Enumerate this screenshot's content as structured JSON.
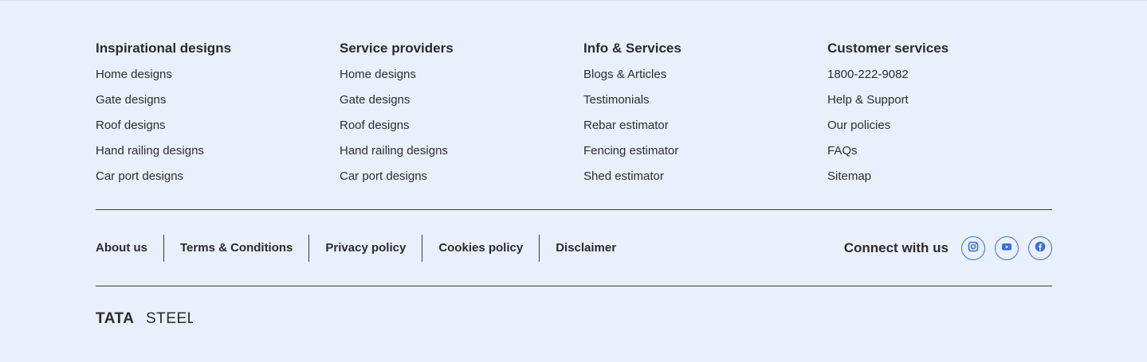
{
  "colors": {
    "background": "#e9f0fb",
    "text": "#2b2b2b",
    "divider": "#3a3a3a",
    "social_accent": "#3b6fd4"
  },
  "columns": [
    {
      "heading": "Inspirational designs",
      "items": [
        "Home designs",
        "Gate designs",
        "Roof designs",
        "Hand railing designs",
        "Car port designs"
      ]
    },
    {
      "heading": "Service providers",
      "items": [
        "Home designs",
        "Gate designs",
        "Roof designs",
        "Hand railing designs",
        "Car port designs"
      ]
    },
    {
      "heading": "Info & Services",
      "items": [
        "Blogs & Articles",
        "Testimonials",
        "Rebar estimator",
        "Fencing estimator",
        "Shed estimator"
      ]
    },
    {
      "heading": "Customer services",
      "items": [
        "1800-222-9082",
        "Help & Support",
        "Our policies",
        "FAQs",
        "Sitemap"
      ]
    }
  ],
  "legal": {
    "about": "About us",
    "terms": "Terms & Conditions",
    "privacy": "Privacy policy",
    "cookies": "Cookies policy",
    "disclaimer": "Disclaimer"
  },
  "connect": {
    "label": "Connect with us",
    "icons": [
      "instagram-icon",
      "youtube-icon",
      "facebook-icon"
    ]
  },
  "brand": {
    "logo": "TATA STEEL"
  }
}
